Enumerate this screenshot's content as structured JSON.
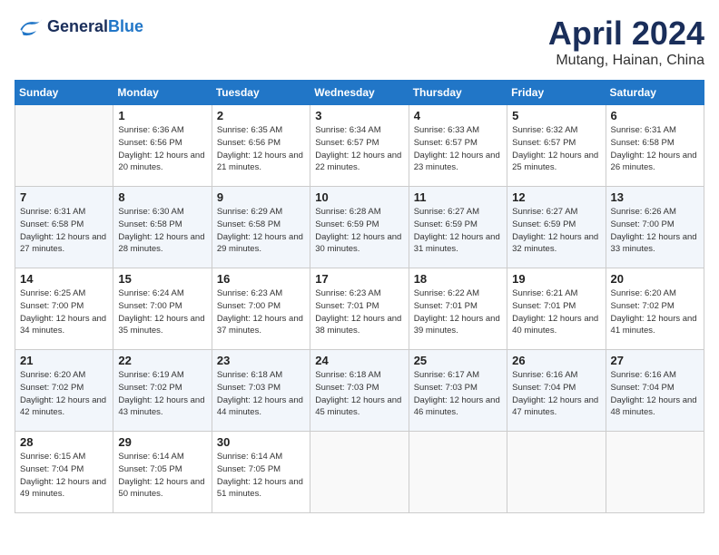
{
  "logo": {
    "line1": "General",
    "line2": "Blue"
  },
  "title": "April 2024",
  "location": "Mutang, Hainan, China",
  "days_of_week": [
    "Sunday",
    "Monday",
    "Tuesday",
    "Wednesday",
    "Thursday",
    "Friday",
    "Saturday"
  ],
  "weeks": [
    [
      {
        "num": "",
        "empty": true
      },
      {
        "num": "1",
        "sunrise": "Sunrise: 6:36 AM",
        "sunset": "Sunset: 6:56 PM",
        "daylight": "Daylight: 12 hours and 20 minutes."
      },
      {
        "num": "2",
        "sunrise": "Sunrise: 6:35 AM",
        "sunset": "Sunset: 6:56 PM",
        "daylight": "Daylight: 12 hours and 21 minutes."
      },
      {
        "num": "3",
        "sunrise": "Sunrise: 6:34 AM",
        "sunset": "Sunset: 6:57 PM",
        "daylight": "Daylight: 12 hours and 22 minutes."
      },
      {
        "num": "4",
        "sunrise": "Sunrise: 6:33 AM",
        "sunset": "Sunset: 6:57 PM",
        "daylight": "Daylight: 12 hours and 23 minutes."
      },
      {
        "num": "5",
        "sunrise": "Sunrise: 6:32 AM",
        "sunset": "Sunset: 6:57 PM",
        "daylight": "Daylight: 12 hours and 25 minutes."
      },
      {
        "num": "6",
        "sunrise": "Sunrise: 6:31 AM",
        "sunset": "Sunset: 6:58 PM",
        "daylight": "Daylight: 12 hours and 26 minutes."
      }
    ],
    [
      {
        "num": "7",
        "sunrise": "Sunrise: 6:31 AM",
        "sunset": "Sunset: 6:58 PM",
        "daylight": "Daylight: 12 hours and 27 minutes."
      },
      {
        "num": "8",
        "sunrise": "Sunrise: 6:30 AM",
        "sunset": "Sunset: 6:58 PM",
        "daylight": "Daylight: 12 hours and 28 minutes."
      },
      {
        "num": "9",
        "sunrise": "Sunrise: 6:29 AM",
        "sunset": "Sunset: 6:58 PM",
        "daylight": "Daylight: 12 hours and 29 minutes."
      },
      {
        "num": "10",
        "sunrise": "Sunrise: 6:28 AM",
        "sunset": "Sunset: 6:59 PM",
        "daylight": "Daylight: 12 hours and 30 minutes."
      },
      {
        "num": "11",
        "sunrise": "Sunrise: 6:27 AM",
        "sunset": "Sunset: 6:59 PM",
        "daylight": "Daylight: 12 hours and 31 minutes."
      },
      {
        "num": "12",
        "sunrise": "Sunrise: 6:27 AM",
        "sunset": "Sunset: 6:59 PM",
        "daylight": "Daylight: 12 hours and 32 minutes."
      },
      {
        "num": "13",
        "sunrise": "Sunrise: 6:26 AM",
        "sunset": "Sunset: 7:00 PM",
        "daylight": "Daylight: 12 hours and 33 minutes."
      }
    ],
    [
      {
        "num": "14",
        "sunrise": "Sunrise: 6:25 AM",
        "sunset": "Sunset: 7:00 PM",
        "daylight": "Daylight: 12 hours and 34 minutes."
      },
      {
        "num": "15",
        "sunrise": "Sunrise: 6:24 AM",
        "sunset": "Sunset: 7:00 PM",
        "daylight": "Daylight: 12 hours and 35 minutes."
      },
      {
        "num": "16",
        "sunrise": "Sunrise: 6:23 AM",
        "sunset": "Sunset: 7:00 PM",
        "daylight": "Daylight: 12 hours and 37 minutes."
      },
      {
        "num": "17",
        "sunrise": "Sunrise: 6:23 AM",
        "sunset": "Sunset: 7:01 PM",
        "daylight": "Daylight: 12 hours and 38 minutes."
      },
      {
        "num": "18",
        "sunrise": "Sunrise: 6:22 AM",
        "sunset": "Sunset: 7:01 PM",
        "daylight": "Daylight: 12 hours and 39 minutes."
      },
      {
        "num": "19",
        "sunrise": "Sunrise: 6:21 AM",
        "sunset": "Sunset: 7:01 PM",
        "daylight": "Daylight: 12 hours and 40 minutes."
      },
      {
        "num": "20",
        "sunrise": "Sunrise: 6:20 AM",
        "sunset": "Sunset: 7:02 PM",
        "daylight": "Daylight: 12 hours and 41 minutes."
      }
    ],
    [
      {
        "num": "21",
        "sunrise": "Sunrise: 6:20 AM",
        "sunset": "Sunset: 7:02 PM",
        "daylight": "Daylight: 12 hours and 42 minutes."
      },
      {
        "num": "22",
        "sunrise": "Sunrise: 6:19 AM",
        "sunset": "Sunset: 7:02 PM",
        "daylight": "Daylight: 12 hours and 43 minutes."
      },
      {
        "num": "23",
        "sunrise": "Sunrise: 6:18 AM",
        "sunset": "Sunset: 7:03 PM",
        "daylight": "Daylight: 12 hours and 44 minutes."
      },
      {
        "num": "24",
        "sunrise": "Sunrise: 6:18 AM",
        "sunset": "Sunset: 7:03 PM",
        "daylight": "Daylight: 12 hours and 45 minutes."
      },
      {
        "num": "25",
        "sunrise": "Sunrise: 6:17 AM",
        "sunset": "Sunset: 7:03 PM",
        "daylight": "Daylight: 12 hours and 46 minutes."
      },
      {
        "num": "26",
        "sunrise": "Sunrise: 6:16 AM",
        "sunset": "Sunset: 7:04 PM",
        "daylight": "Daylight: 12 hours and 47 minutes."
      },
      {
        "num": "27",
        "sunrise": "Sunrise: 6:16 AM",
        "sunset": "Sunset: 7:04 PM",
        "daylight": "Daylight: 12 hours and 48 minutes."
      }
    ],
    [
      {
        "num": "28",
        "sunrise": "Sunrise: 6:15 AM",
        "sunset": "Sunset: 7:04 PM",
        "daylight": "Daylight: 12 hours and 49 minutes."
      },
      {
        "num": "29",
        "sunrise": "Sunrise: 6:14 AM",
        "sunset": "Sunset: 7:05 PM",
        "daylight": "Daylight: 12 hours and 50 minutes."
      },
      {
        "num": "30",
        "sunrise": "Sunrise: 6:14 AM",
        "sunset": "Sunset: 7:05 PM",
        "daylight": "Daylight: 12 hours and 51 minutes."
      },
      {
        "num": "",
        "empty": true
      },
      {
        "num": "",
        "empty": true
      },
      {
        "num": "",
        "empty": true
      },
      {
        "num": "",
        "empty": true
      }
    ]
  ]
}
